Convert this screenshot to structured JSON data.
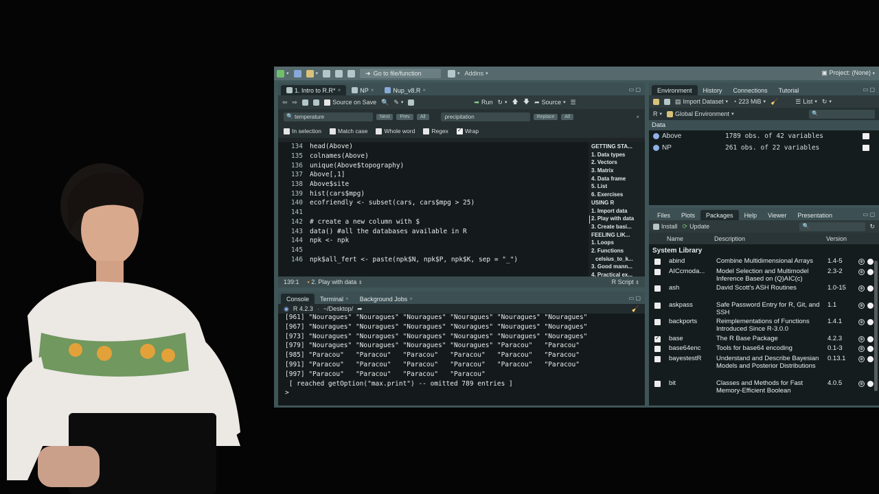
{
  "toolbar": {
    "goto": "Go to file/function",
    "addins": "Addins",
    "project": "Project: (None)"
  },
  "editor": {
    "tabs": [
      {
        "label": "1. Intro to R.R*"
      },
      {
        "label": "NP"
      },
      {
        "label": "Nup_v8.R"
      }
    ],
    "source_on_save": "Source on Save",
    "run": "Run",
    "source": "Source",
    "find": {
      "search_value": "temperature",
      "next": "Next",
      "prev": "Prev",
      "all": "All",
      "replace_value": "precipitation",
      "replace": "Replace",
      "replace_all": "All"
    },
    "options": {
      "in_selection": "In selection",
      "match_case": "Match case",
      "whole_word": "Whole word",
      "regex": "Regex",
      "wrap": "Wrap"
    },
    "lines": [
      {
        "n": "134",
        "code": "head(Above)"
      },
      {
        "n": "135",
        "code": "colnames(Above)"
      },
      {
        "n": "136",
        "code": "unique(Above$topography)"
      },
      {
        "n": "137",
        "code": "Above[,1]"
      },
      {
        "n": "138",
        "code": "Above$site"
      },
      {
        "n": "139",
        "code": "hist(cars$mpg)"
      },
      {
        "n": "140",
        "code": "ecofriendly <- subset(cars, cars$mpg > 25)"
      },
      {
        "n": "141",
        "code": ""
      },
      {
        "n": "142",
        "code": "# create a new column with $"
      },
      {
        "n": "143",
        "code": "data() #all the databases available in R"
      },
      {
        "n": "144",
        "code": "npk <- npk"
      },
      {
        "n": "145",
        "code": ""
      },
      {
        "n": "146",
        "code": "npk$all_fert <- paste(npk$N, npk$P, npk$K, sep = \"_\")"
      }
    ],
    "outline": [
      "GETTING STA...",
      "1. Data types",
      "2. Vectors",
      "3. Matrix",
      "4. Data frame",
      "5. List",
      "6. Exercises",
      "USING R",
      "1. Import data",
      "2. Play with data",
      "3. Create basi...",
      "FEELING LIK...",
      "1. Loops",
      "2. Functions",
      "celsius_to_k...",
      "3. Good mann...",
      "4. Practical ex..."
    ],
    "status": {
      "position": "139:1",
      "section": "2. Play with data",
      "filetype": "R Script"
    }
  },
  "console": {
    "tabs": [
      "Console",
      "Terminal",
      "Background Jobs"
    ],
    "version": "R 4.2.3",
    "path": "~/Desktop/",
    "lines": [
      "[961] \"Nouragues\" \"Nouragues\" \"Nouragues\" \"Nouragues\" \"Nouragues\" \"Nouragues\"",
      "[967] \"Nouragues\" \"Nouragues\" \"Nouragues\" \"Nouragues\" \"Nouragues\" \"Nouragues\"",
      "[973] \"Nouragues\" \"Nouragues\" \"Nouragues\" \"Nouragues\" \"Nouragues\" \"Nouragues\"",
      "[979] \"Nouragues\" \"Nouragues\" \"Nouragues\" \"Nouragues\" \"Paracou\"   \"Paracou\"",
      "[985] \"Paracou\"   \"Paracou\"   \"Paracou\"   \"Paracou\"   \"Paracou\"   \"Paracou\"",
      "[991] \"Paracou\"   \"Paracou\"   \"Paracou\"   \"Paracou\"   \"Paracou\"   \"Paracou\"",
      "[997] \"Paracou\"   \"Paracou\"   \"Paracou\"   \"Paracou\"",
      " [ reached getOption(\"max.print\") -- omitted 789 entries ]",
      ">"
    ]
  },
  "environment": {
    "tabs": [
      "Environment",
      "History",
      "Connections",
      "Tutorial"
    ],
    "import": "Import Dataset",
    "memory": "223 MiB",
    "view": "List",
    "lang": "R",
    "scope": "Global Environment",
    "section": "Data",
    "rows": [
      {
        "name": "Above",
        "value": "1789 obs. of 42 variables"
      },
      {
        "name": "NP",
        "value": "261 obs. of 22 variables"
      }
    ]
  },
  "packages": {
    "tabs": [
      "Files",
      "Plots",
      "Packages",
      "Help",
      "Viewer",
      "Presentation"
    ],
    "install": "Install",
    "update": "Update",
    "headers": {
      "name": "Name",
      "description": "Description",
      "version": "Version"
    },
    "section": "System Library",
    "rows": [
      {
        "name": "abind",
        "desc": "Combine Multidimensional Arrays",
        "ver": "1.4-5",
        "checked": false
      },
      {
        "name": "AICcmoda...",
        "desc": "Model Selection and Multimodel Inference Based on (Q)AIC(c)",
        "ver": "2.3-2",
        "checked": false
      },
      {
        "name": "ash",
        "desc": "David Scott's ASH Routines",
        "ver": "1.0-15",
        "checked": false
      },
      {
        "name": "askpass",
        "desc": "Safe Password Entry for R, Git, and SSH",
        "ver": "1.1",
        "checked": false
      },
      {
        "name": "backports",
        "desc": "Reimplementations of Functions Introduced Since R-3.0.0",
        "ver": "1.4.1",
        "checked": false
      },
      {
        "name": "base",
        "desc": "The R Base Package",
        "ver": "4.2.3",
        "checked": true
      },
      {
        "name": "base64enc",
        "desc": "Tools for base64 encoding",
        "ver": "0.1-3",
        "checked": false
      },
      {
        "name": "bayestestR",
        "desc": "Understand and Describe Bayesian Models and Posterior Distributions",
        "ver": "0.13.1",
        "checked": false
      },
      {
        "name": "bit",
        "desc": "Classes and Methods for Fast Memory-Efficient Boolean",
        "ver": "4.0.5",
        "checked": false
      }
    ]
  }
}
